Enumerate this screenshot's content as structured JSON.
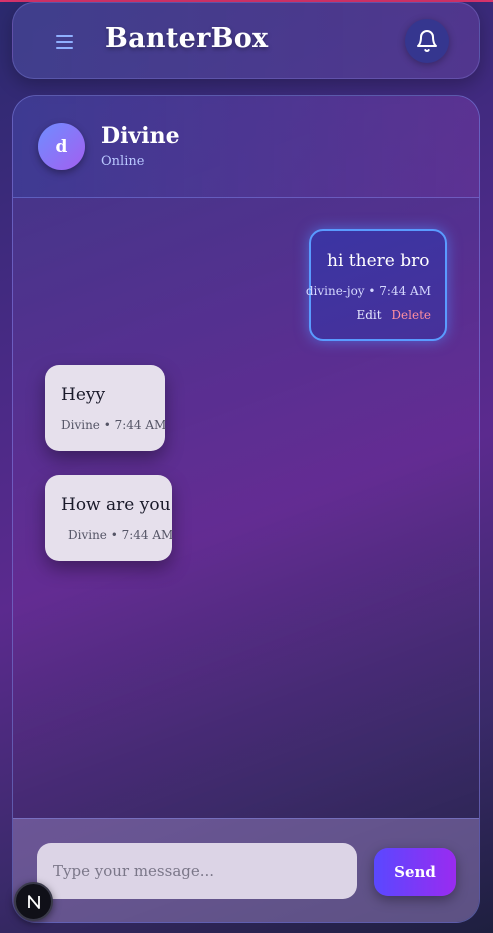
{
  "app": {
    "title": "BanterBox"
  },
  "navbar": {
    "menu_icon": "hamburger-menu-icon",
    "notification_icon": "bell-icon"
  },
  "contact": {
    "avatar_initial": "d",
    "name": "Divine",
    "status": "Online"
  },
  "messages": [
    {
      "sender": "me",
      "text": "hi there bro",
      "meta": "divine-joy • 7:44 AM",
      "edit_label": "Edit",
      "delete_label": "Delete"
    },
    {
      "sender": "them",
      "text": "Heyy",
      "meta": "Divine • 7:44 AM"
    },
    {
      "sender": "them",
      "text": "How are you",
      "meta": "Divine • 7:44 AM"
    }
  ],
  "composer": {
    "placeholder": "Type your message...",
    "value": "",
    "send_label": "Send"
  },
  "dev_badge": {
    "label": "N"
  },
  "colors": {
    "accent_start": "#5a48ff",
    "accent_end": "#9a2bf0",
    "delete": "#ff8fa0",
    "online": "#b9c7ff"
  }
}
